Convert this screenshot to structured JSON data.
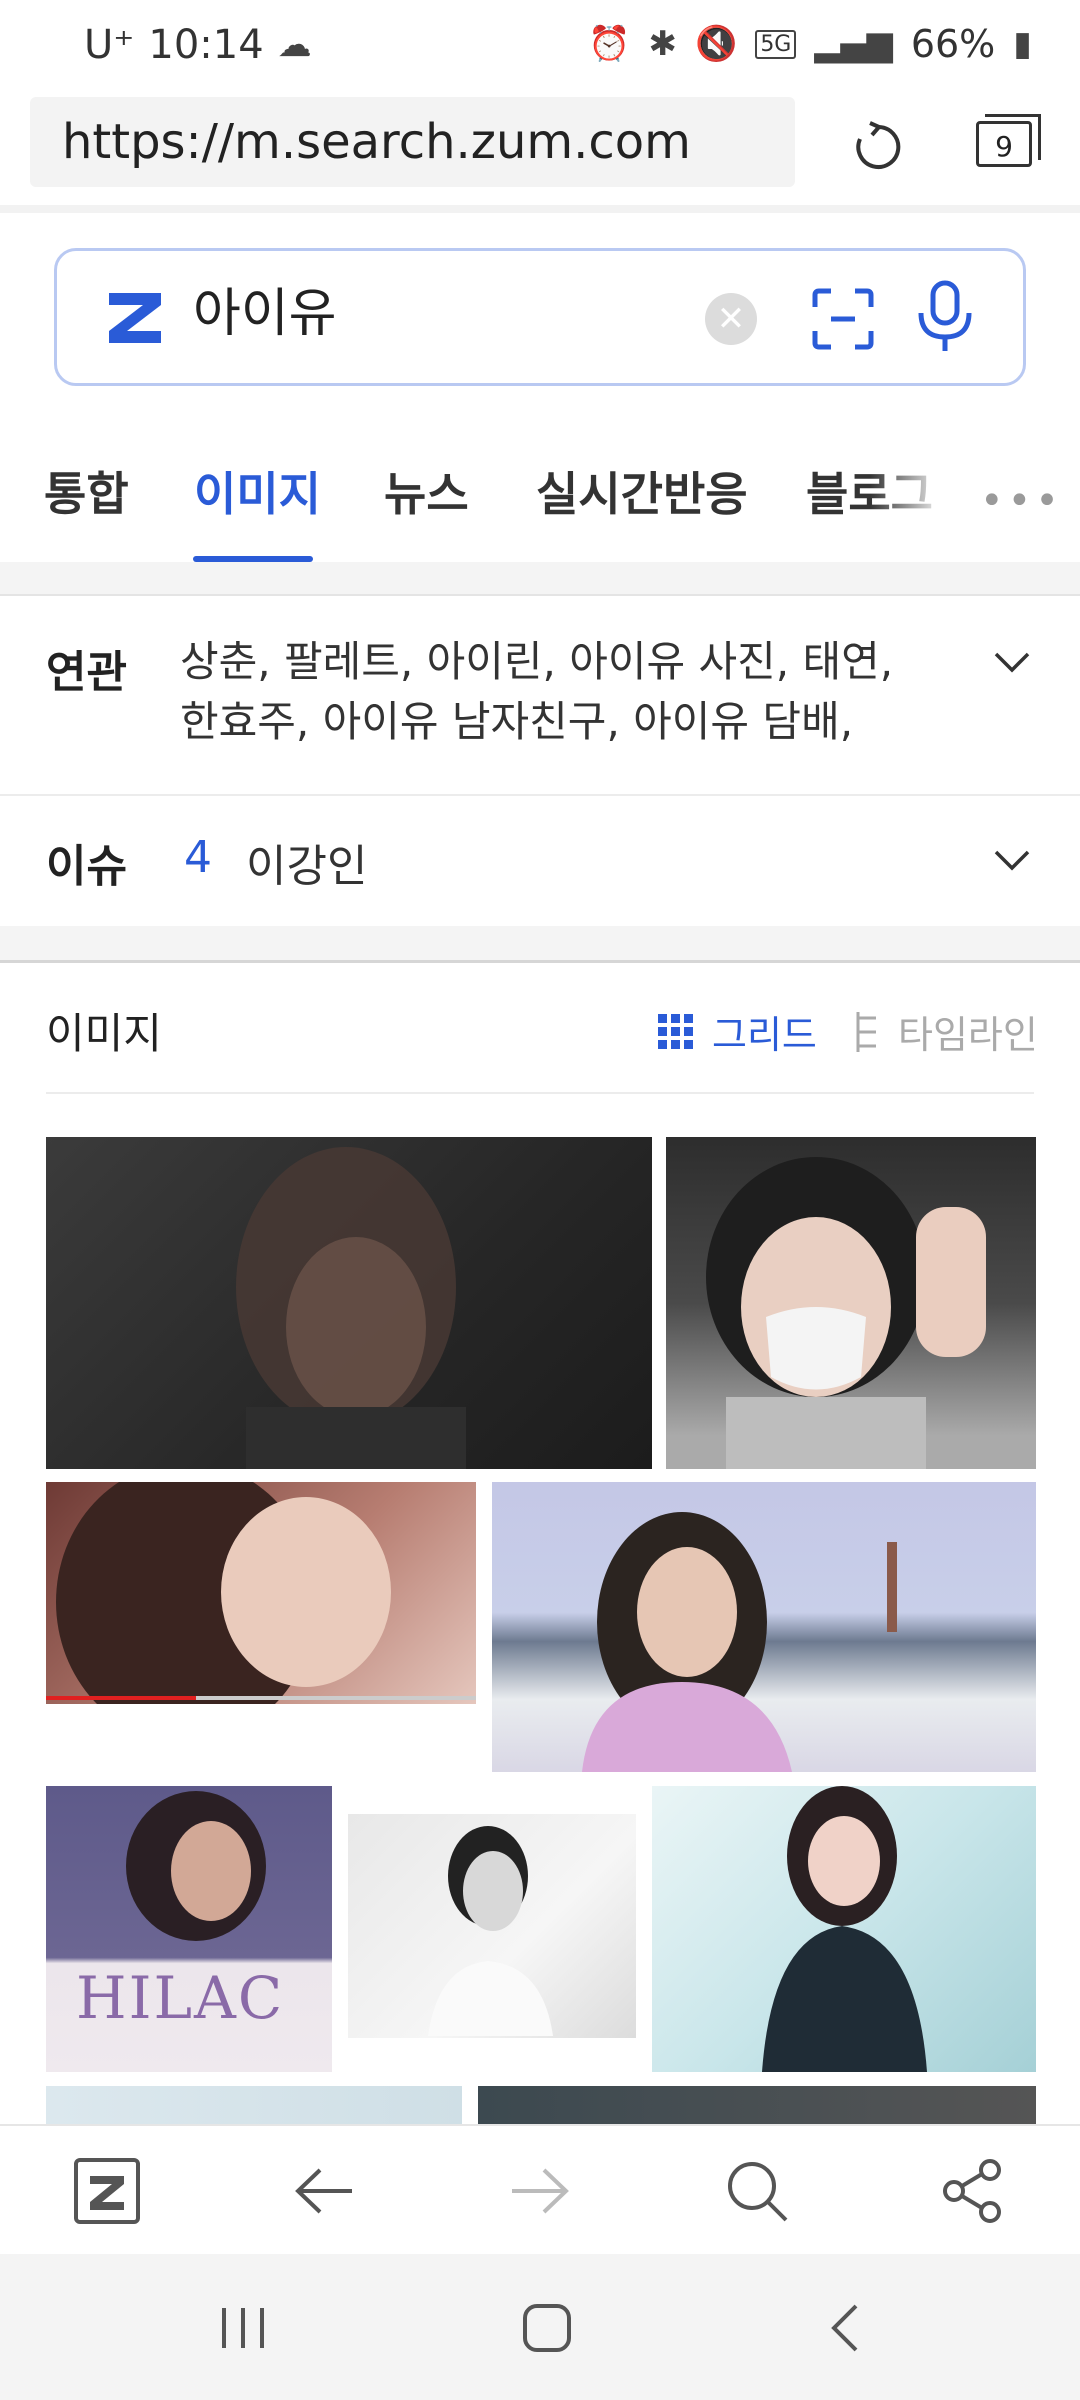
{
  "status_bar": {
    "carrier": "U⁺",
    "time": "10:14",
    "network": "5G",
    "battery": "66%"
  },
  "browser": {
    "url": "https://m.search.zum.com",
    "tab_count": "9"
  },
  "search": {
    "query": "아이유"
  },
  "tabs": [
    {
      "label": "통합",
      "active": false
    },
    {
      "label": "이미지",
      "active": true
    },
    {
      "label": "뉴스",
      "active": false
    },
    {
      "label": "실시간반응",
      "active": false
    },
    {
      "label": "블로그",
      "active": false
    }
  ],
  "related": {
    "label": "연관",
    "line1": "상춘, 팔레트, 아이린, 아이유 사진, 태연,",
    "line2": "한효주, 아이유 남자친구, 아이유 담배,"
  },
  "issue": {
    "label": "이슈",
    "rank": "4",
    "text": "이강인"
  },
  "images_section": {
    "title": "이미지",
    "grid_label": "그리드",
    "timeline_label": "타임라인"
  },
  "thumbnail_texts": {
    "hilac": "HILAC"
  },
  "colors": {
    "accent": "#2a5bd7",
    "search_border": "#b9c9f2"
  }
}
